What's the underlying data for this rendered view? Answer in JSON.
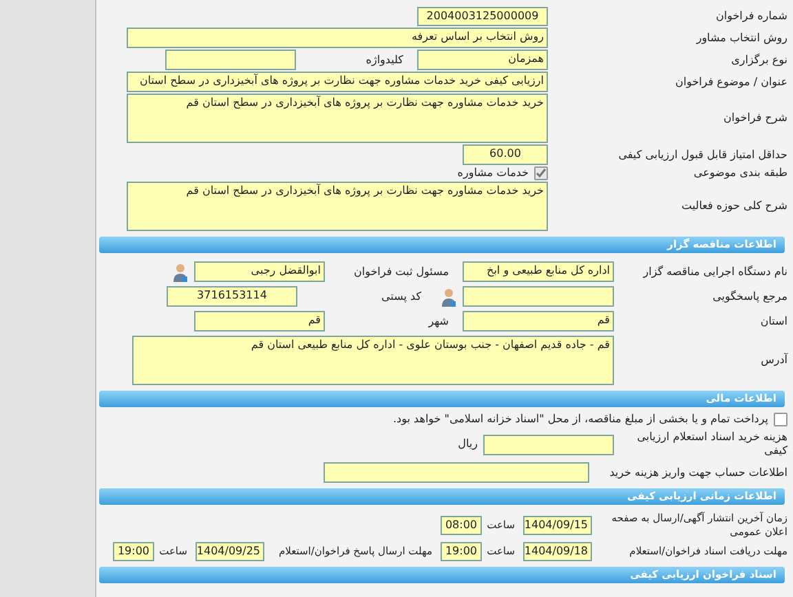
{
  "call": {
    "number": {
      "label": "شماره فراخوان",
      "value": "2004003125000009"
    },
    "method": {
      "label": "روش انتخاب مشاور",
      "value": "روش انتخاب بر اساس تعرفه"
    },
    "holding_type": {
      "label": "نوع برگزاری",
      "value": "همزمان"
    },
    "keyword": {
      "label": "کلیدواژه"
    },
    "subject": {
      "label": "عنوان / موضوع فراخوان",
      "value": "ارزیابی کیفی خرید خدمات مشاوره جهت نظارت بر پروژه های آبخیزداری در سطح استان"
    },
    "description": {
      "label": "شرح فراخوان",
      "value": "خرید خدمات مشاوره جهت نظارت بر پروژه های آبخیزداری در سطح استان قم"
    },
    "min_score": {
      "label": "حداقل امتیاز قابل قبول ارزیابی کیفی",
      "value": "60.00"
    },
    "category": {
      "label": "طبقه بندی موضوعی",
      "option": "خدمات مشاوره",
      "checked": true
    },
    "activity": {
      "label": "شرح کلی حوزه فعالیت",
      "value": "خرید خدمات مشاوره جهت نظارت بر پروژه های آبخیزداری در سطح استان قم"
    }
  },
  "organizer": {
    "title": "اطلاعات مناقصه گزار",
    "agency": {
      "label": "نام دستگاه اجرایی مناقصه گزار",
      "value": "اداره کل منابع طبیعی و ابخ"
    },
    "registrar": {
      "label": "مسئول ثبت فراخوان",
      "value": "ابوالقضل رجبی"
    },
    "responder": {
      "label": "مرجع پاسخگویی"
    },
    "postal_code": {
      "label": "کد پستی",
      "value": "3716153114"
    },
    "province": {
      "label": "استان",
      "value": "قم"
    },
    "city": {
      "label": "شهر",
      "value": "قم"
    },
    "address": {
      "label": "آدرس",
      "value": "قم - جاده قدیم اصفهان - جنب بوستان علوی - اداره کل منابع طبیعی استان قم"
    }
  },
  "financial": {
    "title": "اطلاعات مالی",
    "treasury": {
      "label": "پرداخت تمام و یا بخشی از مبلغ مناقصه، از محل \"اسناد خزانه اسلامی\" خواهد بود.",
      "checked": false
    },
    "fee": {
      "label": "هزینه خرید اسناد استعلام ارزیابی کیفی",
      "unit": "ریال"
    },
    "account": {
      "label": "اطلاعات حساب جهت واریز هزینه خرید"
    }
  },
  "schedule": {
    "title": "اطلاعات زمانی ارزیابی کیفی",
    "publish": {
      "label": "زمان آخرین انتشار آگهی/ارسال به صفحه اعلان عمومی",
      "date": "1404/09/15",
      "time_label": "ساعت",
      "time": "08:00"
    },
    "receive": {
      "label": "مهلت دریافت اسناد فراخوان/استعلام",
      "date": "1404/09/18",
      "time_label": "ساعت",
      "time": "19:00"
    },
    "submit": {
      "label": "مهلت ارسال پاسخ فراخوان/استعلام",
      "date": "1404/09/25",
      "time_label": "ساعت",
      "time": "19:00"
    }
  },
  "documents": {
    "title": "اسناد فراخوان ارزیابی کیفی"
  }
}
